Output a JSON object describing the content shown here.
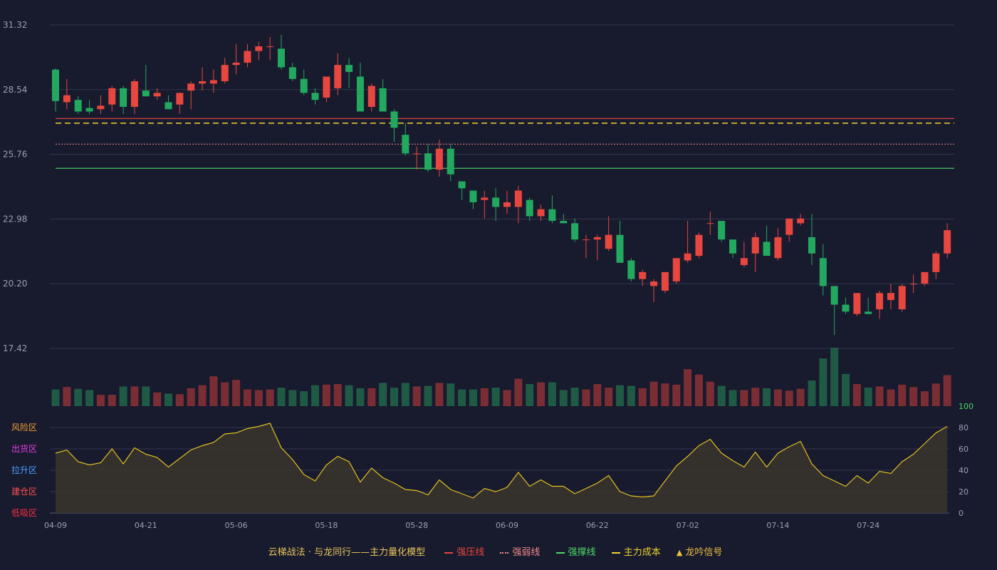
{
  "colors": {
    "background": "#181a2e",
    "up": "#e8473f",
    "down": "#23a95f",
    "up_volume": "#7a2e34",
    "down_volume": "#1f5a45",
    "grid": "#33364d",
    "axis_text": "#9aa0b4",
    "pressure": "#e8473f",
    "weak": "#f28c8c",
    "support": "#4cd964",
    "cost": "#f0d030",
    "oscillator": "#e0c020",
    "zone_risk": "#f0a030",
    "zone_ship": "#e040e0",
    "zone_lift": "#4aa0ff",
    "zone_build": "#ff5050",
    "zone_absorb": "#ff3040",
    "right_axis_top": "#4cd964"
  },
  "chart_data": {
    "type": "candlestick",
    "price_axis": {
      "ticks": [
        "31.32",
        "28.54",
        "25.76",
        "22.98",
        "20.20",
        "17.42"
      ],
      "ylim": [
        17.42,
        31.32
      ]
    },
    "x_ticks": [
      {
        "index": 0,
        "label": "04-09"
      },
      {
        "index": 8,
        "label": "04-21"
      },
      {
        "index": 16,
        "label": "05-06"
      },
      {
        "index": 24,
        "label": "05-18"
      },
      {
        "index": 32,
        "label": "05-28"
      },
      {
        "index": 40,
        "label": "06-09"
      },
      {
        "index": 48,
        "label": "06-22"
      },
      {
        "index": 56,
        "label": "07-02"
      },
      {
        "index": 64,
        "label": "07-14"
      },
      {
        "index": 72,
        "label": "07-24"
      }
    ],
    "ohlc": [
      [
        29.4,
        29.45,
        27.6,
        28.05
      ],
      [
        28.0,
        29.0,
        27.7,
        28.3
      ],
      [
        28.1,
        28.25,
        27.5,
        27.6
      ],
      [
        27.75,
        28.1,
        27.5,
        27.6
      ],
      [
        27.7,
        28.3,
        27.5,
        27.85
      ],
      [
        27.9,
        28.7,
        27.6,
        28.6
      ],
      [
        28.6,
        28.7,
        27.5,
        27.8
      ],
      [
        27.8,
        29.0,
        27.5,
        28.9
      ],
      [
        28.5,
        29.6,
        28.3,
        28.25
      ],
      [
        28.25,
        28.6,
        28.1,
        28.4
      ],
      [
        28.0,
        28.3,
        27.7,
        27.7
      ],
      [
        27.9,
        28.4,
        27.5,
        28.4
      ],
      [
        28.5,
        28.9,
        27.7,
        28.8
      ],
      [
        28.8,
        29.5,
        28.5,
        28.9
      ],
      [
        28.8,
        29.4,
        28.4,
        28.95
      ],
      [
        28.9,
        29.9,
        28.8,
        29.6
      ],
      [
        29.6,
        30.5,
        29.2,
        29.7
      ],
      [
        29.7,
        30.5,
        29.5,
        30.2
      ],
      [
        30.2,
        30.6,
        29.8,
        30.4
      ],
      [
        30.4,
        30.8,
        29.8,
        30.4
      ],
      [
        30.3,
        30.9,
        29.4,
        29.5
      ],
      [
        29.5,
        29.7,
        28.9,
        29.0
      ],
      [
        29.0,
        29.4,
        28.3,
        28.4
      ],
      [
        28.4,
        28.6,
        27.9,
        28.1
      ],
      [
        28.2,
        29.1,
        28.0,
        29.1
      ],
      [
        28.6,
        30.1,
        28.3,
        29.6
      ],
      [
        29.6,
        29.9,
        28.6,
        29.3
      ],
      [
        29.1,
        29.7,
        27.6,
        27.6
      ],
      [
        27.8,
        28.8,
        27.6,
        28.7
      ],
      [
        28.6,
        29.0,
        27.7,
        27.6
      ],
      [
        27.6,
        27.7,
        26.3,
        26.9
      ],
      [
        26.6,
        27.1,
        25.7,
        25.8
      ],
      [
        25.8,
        26.1,
        25.1,
        25.8
      ],
      [
        25.8,
        26.2,
        25.0,
        25.1
      ],
      [
        25.1,
        26.4,
        24.8,
        26.0
      ],
      [
        26.0,
        26.2,
        24.6,
        24.9
      ],
      [
        24.6,
        24.6,
        23.8,
        24.3
      ],
      [
        24.2,
        24.2,
        23.4,
        23.7
      ],
      [
        23.8,
        24.2,
        23.0,
        23.9
      ],
      [
        23.9,
        24.3,
        22.9,
        23.5
      ],
      [
        23.5,
        24.2,
        23.2,
        23.7
      ],
      [
        23.5,
        24.4,
        22.8,
        24.2
      ],
      [
        23.8,
        23.9,
        22.9,
        23.1
      ],
      [
        23.1,
        23.6,
        22.9,
        23.4
      ],
      [
        23.4,
        24.0,
        22.8,
        22.9
      ],
      [
        22.9,
        23.2,
        22.8,
        22.8
      ],
      [
        22.8,
        23.0,
        22.0,
        22.1
      ],
      [
        22.1,
        22.3,
        21.3,
        22.1
      ],
      [
        22.1,
        22.3,
        21.2,
        22.2
      ],
      [
        21.7,
        23.1,
        21.6,
        22.3
      ],
      [
        22.3,
        22.9,
        21.1,
        21.1
      ],
      [
        21.2,
        21.3,
        20.3,
        20.4
      ],
      [
        20.4,
        20.8,
        20.1,
        20.7
      ],
      [
        20.1,
        20.4,
        19.4,
        20.3
      ],
      [
        19.9,
        20.5,
        19.8,
        20.7
      ],
      [
        20.3,
        21.3,
        20.2,
        21.3
      ],
      [
        21.2,
        22.9,
        21.1,
        21.5
      ],
      [
        21.4,
        22.4,
        21.3,
        22.3
      ],
      [
        22.8,
        23.3,
        22.3,
        22.8
      ],
      [
        22.9,
        22.9,
        22.0,
        22.1
      ],
      [
        22.1,
        22.1,
        21.3,
        21.5
      ],
      [
        21.0,
        22.0,
        20.9,
        21.3
      ],
      [
        21.5,
        22.4,
        20.7,
        22.2
      ],
      [
        22.0,
        22.7,
        21.5,
        21.4
      ],
      [
        21.3,
        22.6,
        21.2,
        22.2
      ],
      [
        22.3,
        23.0,
        22.0,
        23.0
      ],
      [
        22.8,
        23.2,
        22.7,
        23.0
      ],
      [
        22.2,
        23.2,
        21.0,
        21.5
      ],
      [
        21.3,
        21.9,
        19.7,
        20.1
      ],
      [
        20.1,
        20.1,
        18.0,
        19.3
      ],
      [
        19.3,
        19.6,
        18.9,
        19.0
      ],
      [
        18.9,
        19.6,
        18.8,
        19.8
      ],
      [
        19.0,
        19.6,
        18.9,
        18.9
      ],
      [
        19.1,
        19.9,
        18.7,
        19.8
      ],
      [
        19.5,
        20.2,
        19.1,
        19.8
      ],
      [
        19.1,
        20.2,
        19.0,
        20.1
      ],
      [
        20.2,
        20.6,
        19.8,
        20.2
      ],
      [
        20.2,
        20.7,
        20.1,
        20.7
      ],
      [
        20.7,
        21.6,
        20.4,
        21.5
      ],
      [
        21.5,
        22.8,
        21.3,
        22.5
      ]
    ],
    "volume": [
      28,
      32,
      29,
      27,
      19,
      19,
      33,
      33,
      33,
      23,
      21,
      20,
      30,
      35,
      50,
      40,
      44,
      28,
      27,
      28,
      31,
      27,
      25,
      35,
      36,
      37,
      35,
      30,
      30,
      39,
      31,
      39,
      33,
      34,
      39,
      38,
      28,
      28,
      30,
      31,
      27,
      46,
      37,
      40,
      40,
      27,
      31,
      28,
      37,
      31,
      35,
      34,
      30,
      41,
      38,
      36,
      62,
      53,
      41,
      34,
      27,
      27,
      31,
      30,
      28,
      26,
      29,
      43,
      80,
      98,
      54,
      37,
      31,
      33,
      28,
      36,
      32,
      25,
      38,
      52
    ],
    "levels": {
      "pressure": 27.3,
      "weak": 26.2,
      "support": 25.16,
      "cost": 27.1
    },
    "oscillator": {
      "zones": [
        "风险区",
        "出货区",
        "拉升区",
        "建仓区",
        "低吸区"
      ],
      "ticks": [
        "100",
        "80",
        "60",
        "40",
        "20",
        "0"
      ],
      "ylim": [
        0,
        100
      ],
      "values": [
        56,
        59,
        48,
        45,
        47,
        60,
        46,
        61,
        55,
        52,
        43,
        51,
        59,
        63,
        66,
        74,
        75,
        79,
        81,
        84,
        61,
        50,
        36,
        30,
        45,
        53,
        48,
        29,
        42,
        33,
        28,
        22,
        21,
        17,
        31,
        22,
        18,
        14,
        23,
        20,
        24,
        38,
        25,
        31,
        25,
        25,
        18,
        23,
        28,
        35,
        20,
        16,
        15,
        16,
        30,
        44,
        53,
        63,
        69,
        56,
        49,
        43,
        57,
        43,
        56,
        62,
        67,
        46,
        35,
        30,
        25,
        35,
        28,
        39,
        37,
        48,
        55,
        65,
        75,
        81
      ]
    }
  },
  "legend": {
    "title": "云梯战法 · 与龙同行——主力量化模型",
    "items": [
      {
        "label": "强压线",
        "color": "#e8473f",
        "style": "solid"
      },
      {
        "label": "强弱线",
        "color": "#f28c8c",
        "style": "dotted"
      },
      {
        "label": "强撑线",
        "color": "#4cd964",
        "style": "solid"
      },
      {
        "label": "主力成本",
        "color": "#f0d030",
        "style": "dashed"
      },
      {
        "label": "龙吟信号",
        "color": "#f0c040",
        "style": "triangle"
      }
    ]
  }
}
